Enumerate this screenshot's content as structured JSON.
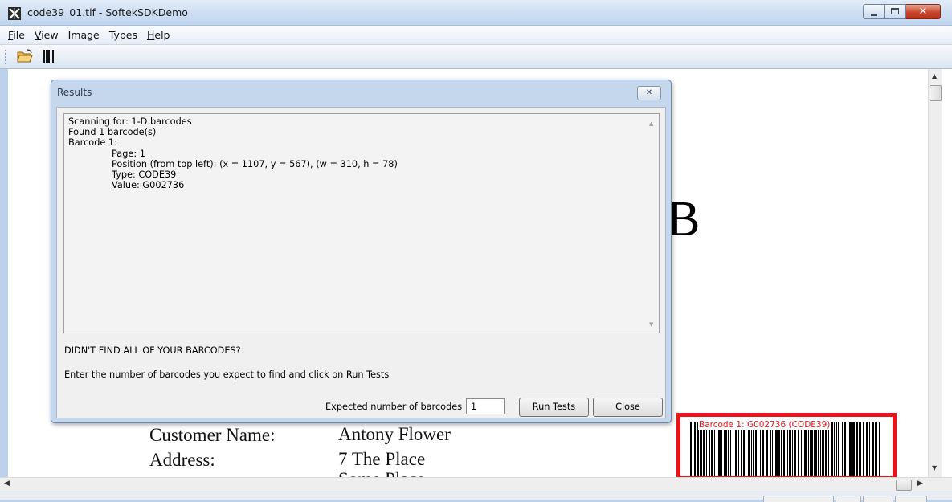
{
  "window": {
    "title": "code39_01.tif - SoftekSDKDemo",
    "close_glyph": "✕"
  },
  "menu": [
    "File",
    "View",
    "Image",
    "Types",
    "Help"
  ],
  "toolbar": {
    "open_icon": "folder-open-icon",
    "scan_icon": "barcode-icon"
  },
  "document": {
    "big_letter": "B",
    "customer_name_label": "Customer Name:",
    "customer_name_value": "Antony Flower",
    "address_label": "Address:",
    "address_value": "7 The Place",
    "address_value_2": "Some Place",
    "barcode_label": "Barcode 1: G002736 (CODE39)",
    "highlight_color": "#e8141a"
  },
  "dialog": {
    "title": "Results",
    "close_glyph": "✕",
    "results": {
      "scanning": "Scanning for: 1-D barcodes",
      "found": "Found 1 barcode(s)",
      "barcode_heading": "Barcode 1:",
      "page": "Page: 1",
      "position": "Position (from top left): (x = 1107, y = 567), (w = 310, h = 78)",
      "type": "Type: CODE39",
      "value": "Value: G002736"
    },
    "hint_heading": "DIDN'T FIND ALL OF YOUR BARCODES?",
    "hint_text": "Enter the number of barcodes you expect to find and click on Run Tests",
    "expected_label": "Expected number of barcodes",
    "expected_value": "1",
    "run_tests_label": "Run Tests",
    "close_label": "Close"
  }
}
